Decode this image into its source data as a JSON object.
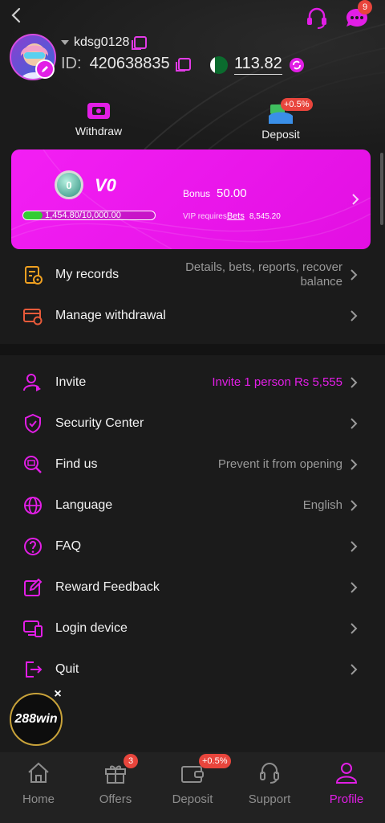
{
  "header": {
    "support_badge": "",
    "chat_badge": "9",
    "username": "kdsg0128",
    "id_label": "ID:",
    "id_value": "420638835",
    "balance": "113.82"
  },
  "actions": {
    "withdraw_label": "Withdraw",
    "deposit_label": "Deposit",
    "deposit_badge": "+0.5%"
  },
  "vip": {
    "medal_level": "0",
    "level": "V0",
    "progress_text": "1,454.80/10,000.00",
    "progress_fraction": 0.145,
    "bonus_label": "Bonus",
    "bonus_value": "50.00",
    "requires_text": "VIP requires",
    "bets_label": "Bets",
    "bets_amount": "8,545.20"
  },
  "group1": [
    {
      "label": "My records",
      "right": "Details, bets, reports, recover balance"
    },
    {
      "label": "Manage withdrawal",
      "right": ""
    }
  ],
  "group2": [
    {
      "label": "Invite",
      "right": "Invite 1 person Rs 5,555"
    },
    {
      "label": "Security Center",
      "right": ""
    },
    {
      "label": "Find us",
      "right": "Prevent it from opening"
    },
    {
      "label": "Language",
      "right": "English"
    },
    {
      "label": "FAQ",
      "right": ""
    },
    {
      "label": "Reward Feedback",
      "right": ""
    },
    {
      "label": "Login device",
      "right": ""
    },
    {
      "label": "Quit",
      "right": ""
    }
  ],
  "promo": {
    "text": "288win",
    "close": "×"
  },
  "tabs": [
    {
      "label": "Home",
      "badge": ""
    },
    {
      "label": "Offers",
      "badge": "3"
    },
    {
      "label": "Deposit",
      "badge": "+0.5%"
    },
    {
      "label": "Support",
      "badge": ""
    },
    {
      "label": "Profile",
      "badge": ""
    }
  ],
  "colors": {
    "accent": "#e21ee6",
    "card": "#f01ff1",
    "bg": "#1b1b1b",
    "invite_text": "#e21ee6",
    "progress": "#33cc33"
  }
}
